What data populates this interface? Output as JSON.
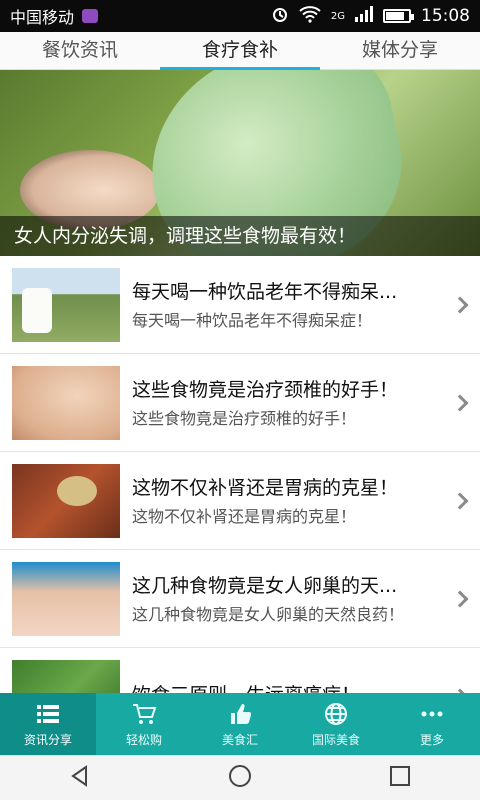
{
  "status_bar": {
    "carrier": "中国移动",
    "network": "2G",
    "time": "15:08",
    "battery_level": 0.85
  },
  "tabs": [
    {
      "label": "餐饮资讯",
      "active": false
    },
    {
      "label": "食疗食补",
      "active": true
    },
    {
      "label": "媒体分享",
      "active": false
    }
  ],
  "banner": {
    "caption": "女人内分泌失调，调理这些食物最有效！"
  },
  "articles": [
    {
      "title": "每天喝一种饮品老年不得痴呆...",
      "summary": "每天喝一种饮品老年不得痴呆症！"
    },
    {
      "title": "这些食物竟是治疗颈椎的好手！",
      "summary": "这些食物竟是治疗颈椎的好手！"
    },
    {
      "title": "这物不仅补肾还是胃病的克星！",
      "summary": "这物不仅补肾还是胃病的克星！"
    },
    {
      "title": "这几种食物竟是女人卵巢的天...",
      "summary": "这几种食物竟是女人卵巢的天然良药！"
    },
    {
      "title": "饮食三原则一生远离癌症！",
      "summary": ""
    }
  ],
  "bottom_nav": [
    {
      "label": "资讯分享",
      "icon": "list-icon",
      "active": true
    },
    {
      "label": "轻松购",
      "icon": "cart-icon",
      "active": false
    },
    {
      "label": "美食汇",
      "icon": "thumbs-up-icon",
      "active": false
    },
    {
      "label": "国际美食",
      "icon": "globe-icon",
      "active": false
    },
    {
      "label": "更多",
      "icon": "more-icon",
      "active": false
    }
  ],
  "colors": {
    "tab_indicator": "#1fb0e0",
    "bottom_bar": "#18a9a3",
    "bottom_bar_active": "#0f8e89"
  }
}
